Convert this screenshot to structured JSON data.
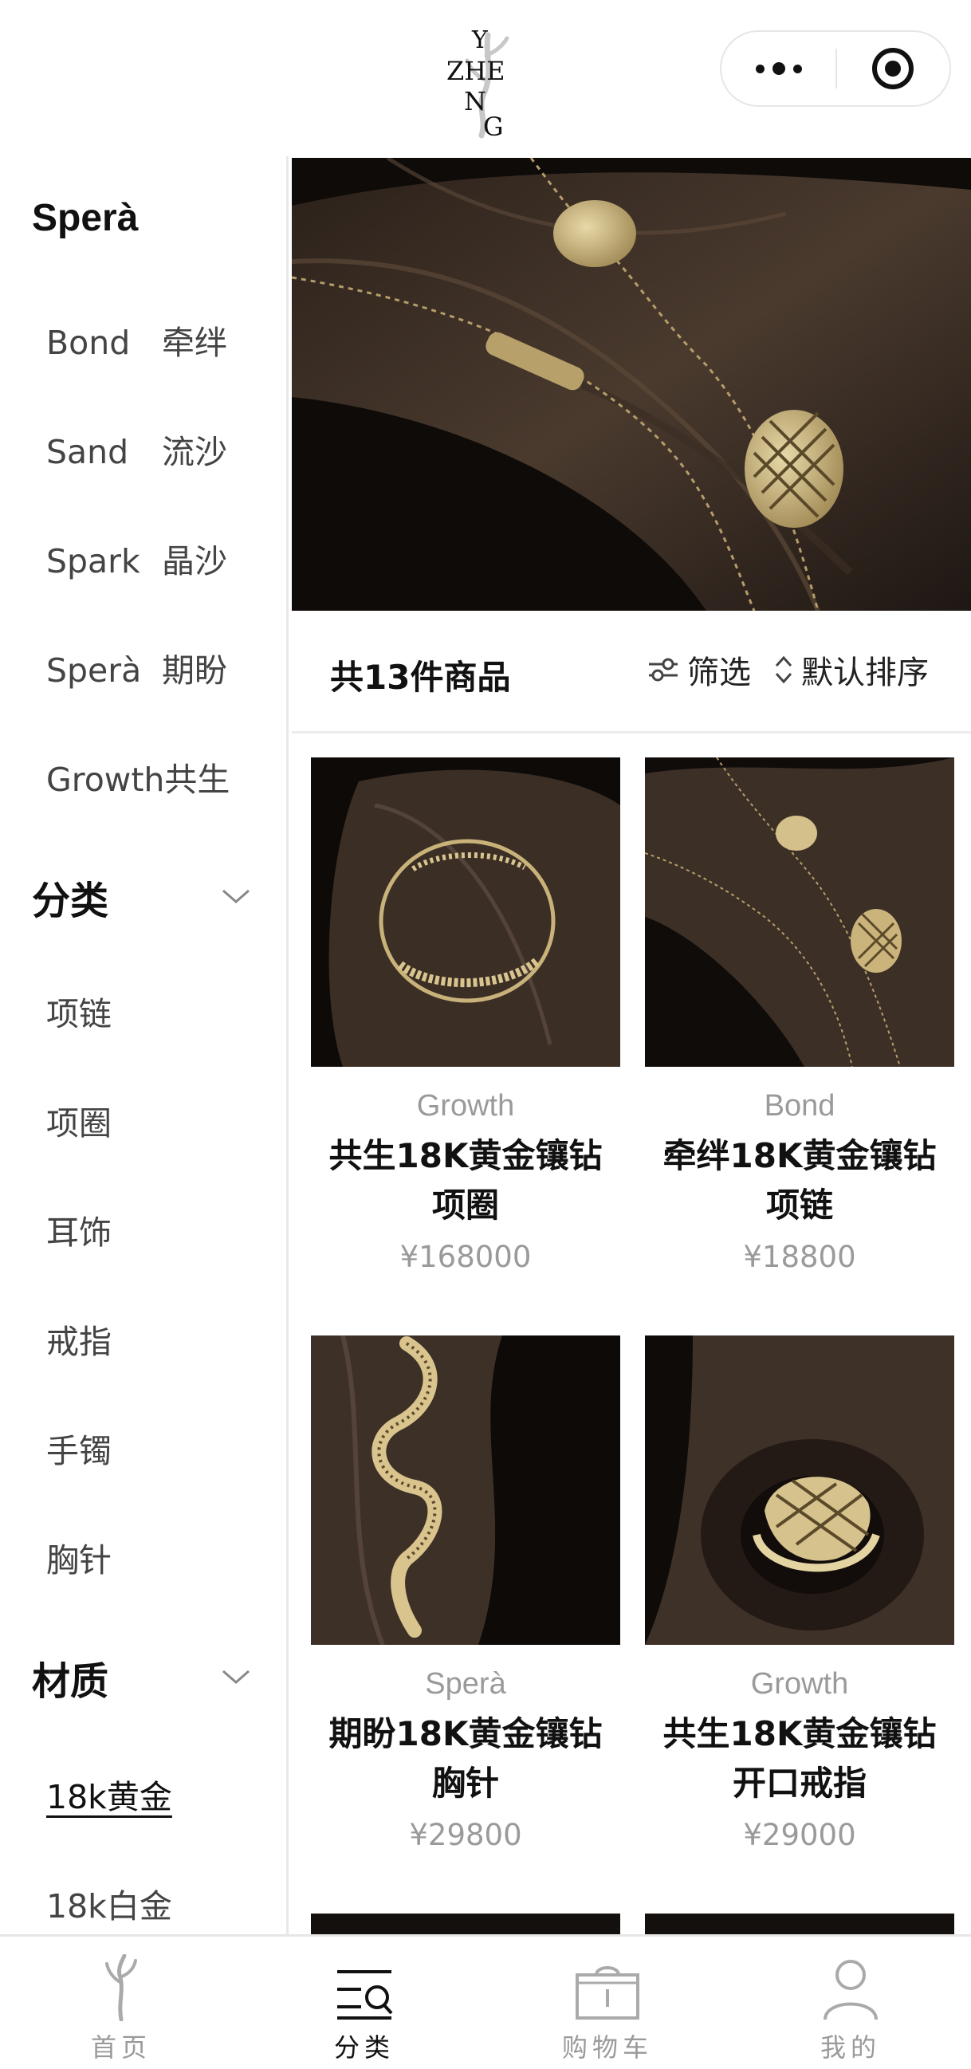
{
  "brand": {
    "logo_text": "YZHENG"
  },
  "capsule": {
    "more_icon": "more-dots-icon",
    "close_icon": "target-close-icon"
  },
  "sidebar": {
    "series_heading": "Sperà",
    "series": [
      {
        "en": "Bond",
        "zh": "牵绊"
      },
      {
        "en": "Sand",
        "zh": "流沙"
      },
      {
        "en": "Spark",
        "zh": "晶沙"
      },
      {
        "en": "Sperà",
        "zh": "期盼"
      },
      {
        "en": "Growth",
        "zh": "共生"
      }
    ],
    "category_heading": "分类",
    "categories": [
      "项链",
      "项圈",
      "耳饰",
      "戒指",
      "手镯",
      "胸针"
    ],
    "material_heading": "材质",
    "materials": [
      "18k黄金",
      "18k白金"
    ],
    "active_material": "18k黄金"
  },
  "listing": {
    "count_text": "共13件商品",
    "filter_label": "筛选",
    "sort_label": "默认排序"
  },
  "products": [
    {
      "series": "Growth",
      "title": "共生18K黄金镶钻项圈",
      "price": "¥168000"
    },
    {
      "series": "Bond",
      "title": "牵绊18K黄金镶钻项链",
      "price": "¥18800"
    },
    {
      "series": "Sperà",
      "title": "期盼18K黄金镶钻胸针",
      "price": "¥29800"
    },
    {
      "series": "Growth",
      "title": "共生18K黄金镶钻开口戒指",
      "price": "¥29000"
    }
  ],
  "tabbar": [
    {
      "label": "首页",
      "icon": "home-tree-icon",
      "active": false
    },
    {
      "label": "分类",
      "icon": "category-search-icon",
      "active": true
    },
    {
      "label": "购物车",
      "icon": "shopping-bag-icon",
      "active": false
    },
    {
      "label": "我的",
      "icon": "profile-icon",
      "active": false
    }
  ],
  "colors": {
    "accent": "#111111",
    "muted": "#9a9a9a",
    "divider": "#e8e8e8",
    "photo_bg": "#14100d",
    "gold": "#c9b27a"
  }
}
